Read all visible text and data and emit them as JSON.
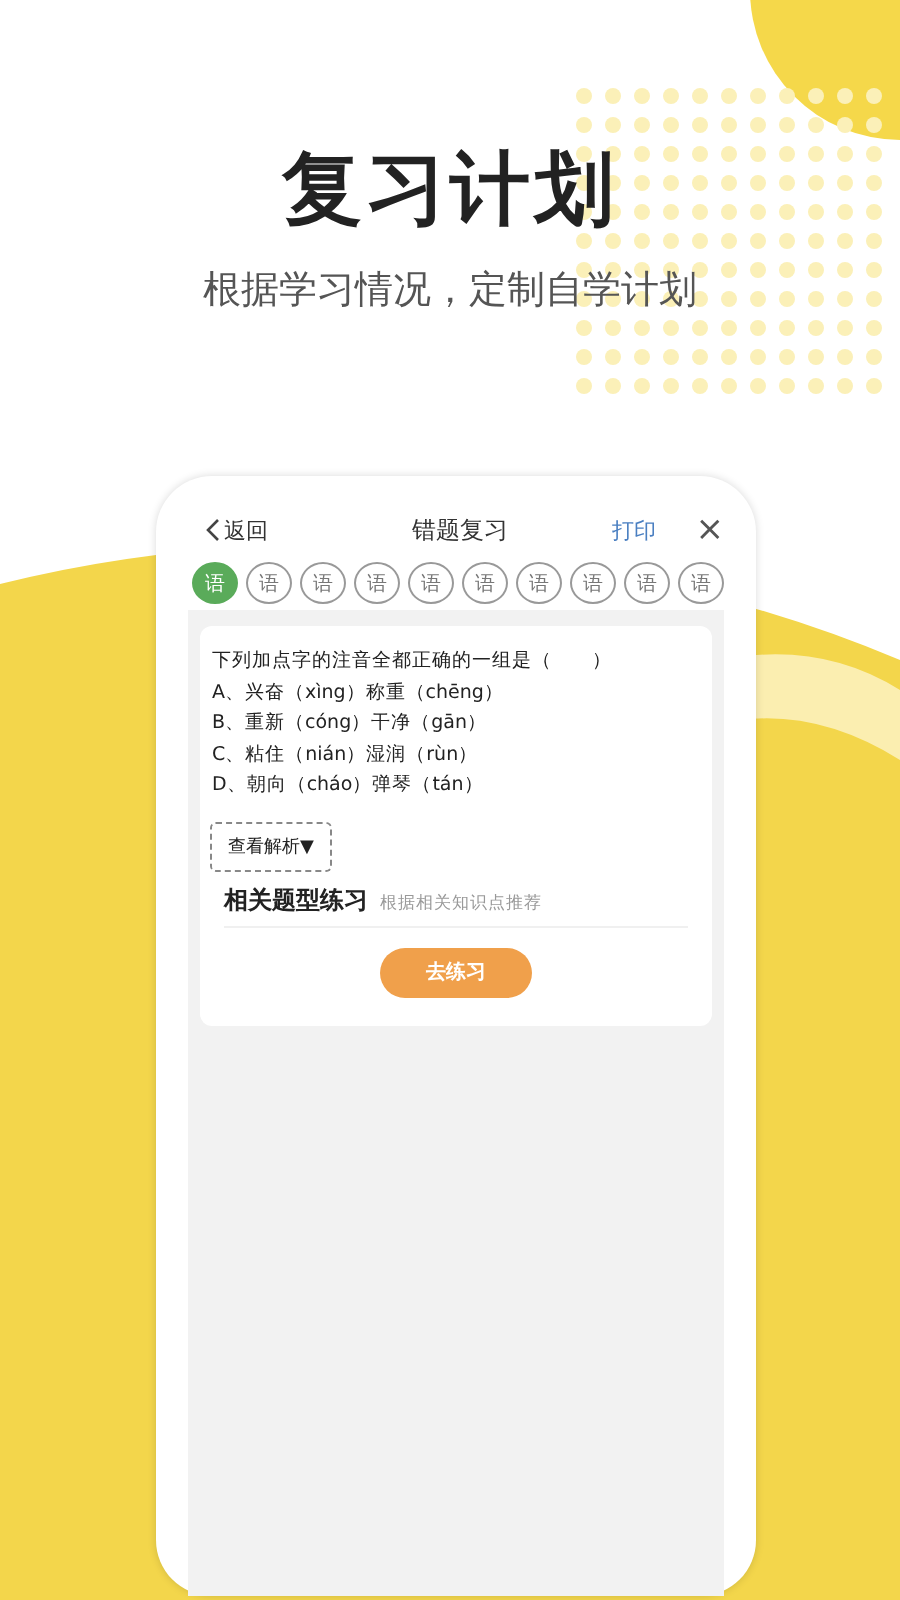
{
  "banner": {
    "title": "复习计划",
    "subtitle": "根据学习情况，定制自学计划"
  },
  "app_bar": {
    "back": "返回",
    "title": "错题复习",
    "print": "打印",
    "close": "×"
  },
  "tabs": [
    {
      "label": "语",
      "selected": true
    },
    {
      "label": "语",
      "selected": false
    },
    {
      "label": "语",
      "selected": false
    },
    {
      "label": "语",
      "selected": false
    },
    {
      "label": "语",
      "selected": false
    },
    {
      "label": "语",
      "selected": false
    },
    {
      "label": "语",
      "selected": false
    },
    {
      "label": "语",
      "selected": false
    },
    {
      "label": "语",
      "selected": false
    },
    {
      "label": "语",
      "selected": false
    }
  ],
  "question": {
    "stem": "下列加点字的注音全都正确的一组是（　　）",
    "options": [
      "A、兴奋（xìng）称重（chēng）",
      "B、重新（cóng）干净（gān）",
      "C、粘住（nián）湿润（rùn）",
      "D、朝向（cháo）弹琴（tán）"
    ],
    "analysis_button": "查看解析▼"
  },
  "related": {
    "title": "相关题型练习",
    "hint": "根据相关知识点推荐",
    "button": "去练习"
  }
}
